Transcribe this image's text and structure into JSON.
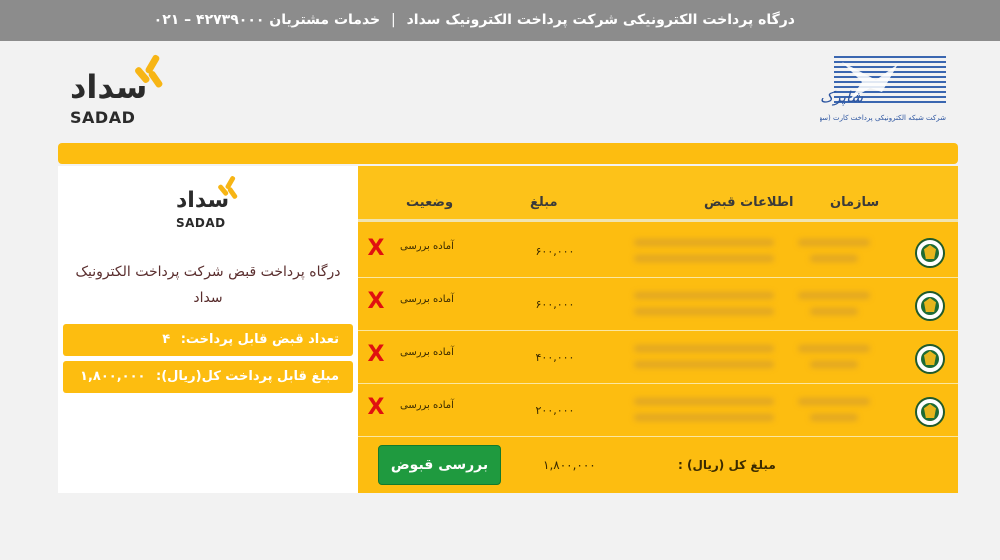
{
  "topbar": {
    "gateway_title": "درگاه پرداخت الکترونیکی شرکت پرداخت الکترونیک سداد",
    "separator": "|",
    "support_label": "خدمات مشتریان",
    "support_phone": "۴۲۷۳۹۰۰۰ – ۰۲۱"
  },
  "header": {
    "sadad_logo": {
      "fa": "سداد",
      "en": "SADAD"
    },
    "shaparak_logo": {
      "name": "شاپرک",
      "subtitle": "شرکت شبکه الکترونیکی پرداخت کارت (سهامی خاص)"
    }
  },
  "sidebar": {
    "logo": {
      "fa": "سداد",
      "en": "SADAD"
    },
    "gateway_text": "درگاه پرداخت قبض شرکت پرداخت الکترونیک سداد",
    "bill_count_label": "تعداد قبض قابل پرداخت:",
    "bill_count_value": "۴",
    "total_payable_label": "مبلغ قابل پرداخت کل(ریال):",
    "total_payable_value": "۱,۸۰۰,۰۰۰"
  },
  "table": {
    "columns": {
      "organization": "سازمان",
      "bill_info": "اطلاعات قبض",
      "amount": "مبلغ",
      "status": "وضعیت"
    },
    "rows": [
      {
        "org_icon": "police-emblem-icon",
        "amount": "۶۰۰,۰۰۰",
        "status": "آماده بررسی",
        "status_icon": "red-x-icon"
      },
      {
        "org_icon": "police-emblem-icon",
        "amount": "۶۰۰,۰۰۰",
        "status": "آماده بررسی",
        "status_icon": "red-x-icon"
      },
      {
        "org_icon": "police-emblem-icon",
        "amount": "۴۰۰,۰۰۰",
        "status": "آماده بررسی",
        "status_icon": "red-x-icon"
      },
      {
        "org_icon": "police-emblem-icon",
        "amount": "۲۰۰,۰۰۰",
        "status": "آماده بررسی",
        "status_icon": "red-x-icon"
      }
    ],
    "x_glyph": "X",
    "footer": {
      "total_label": "مبلغ کل (ریال) :",
      "total_value": "۱,۸۰۰,۰۰۰",
      "check_button_label": "بررسی قبوض"
    }
  },
  "colors": {
    "topbar_bg": "#8c8c8c",
    "accent_yellow": "#fdbd10",
    "button_green": "#1f9a3f",
    "x_red": "#e01010",
    "logo_orange": "#f7b515",
    "shaparak_blue": "#3a66b0"
  }
}
